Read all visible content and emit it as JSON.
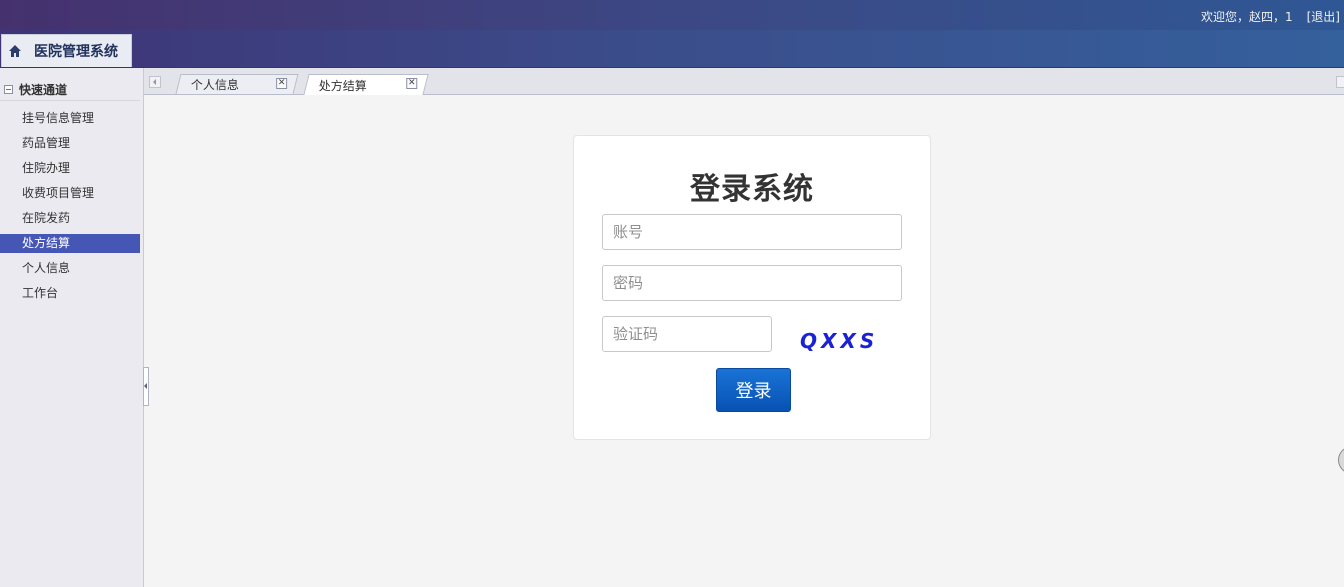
{
  "topbar": {
    "welcome": "欢迎您，赵四，1",
    "logout": "[退出]"
  },
  "header": {
    "app_title": "医院管理系统"
  },
  "sidebar": {
    "section_title": "快速通道",
    "items": [
      {
        "label": "挂号信息管理",
        "active": false
      },
      {
        "label": "药品管理",
        "active": false
      },
      {
        "label": "住院办理",
        "active": false
      },
      {
        "label": "收费项目管理",
        "active": false
      },
      {
        "label": "在院发药",
        "active": false
      },
      {
        "label": "处方结算",
        "active": true
      },
      {
        "label": "个人信息",
        "active": false
      },
      {
        "label": "工作台",
        "active": false
      }
    ]
  },
  "tabs": [
    {
      "label": "个人信息",
      "active": false
    },
    {
      "label": "处方结算",
      "active": true
    }
  ],
  "login": {
    "title": "登录系统",
    "account_placeholder": "账号",
    "password_placeholder": "密码",
    "captcha_placeholder": "验证码",
    "captcha_text": "QXXS",
    "submit_label": "登录"
  },
  "colors": {
    "header_start": "#45316e",
    "header_end": "#2f5794",
    "sidebar_active": "#4656b5",
    "login_button": "#0a5fc4",
    "captcha": "#1a22d6"
  },
  "icons": {
    "home": "home-icon",
    "tab_close": "close-icon"
  }
}
